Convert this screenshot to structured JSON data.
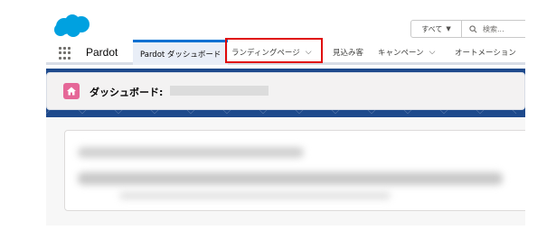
{
  "topbar": {
    "logo": "salesforce-cloud-logo",
    "search_scope": "すべて",
    "search_placeholder": "検索..."
  },
  "nav": {
    "app_name": "Pardot",
    "items": [
      {
        "label": "Pardot ダッシュボード",
        "active": true,
        "has_menu": false
      },
      {
        "label": "ランディングページ",
        "active": false,
        "has_menu": true
      },
      {
        "label": "見込み客",
        "active": false,
        "has_menu": false
      },
      {
        "label": "キャンペーン",
        "active": false,
        "has_menu": true
      },
      {
        "label": "オートメーション",
        "active": false,
        "has_menu": false
      }
    ]
  },
  "header": {
    "title": "ダッシュボード:",
    "icon": "home-icon"
  },
  "colors": {
    "brand_blue": "#00a1e0",
    "active_tab_border": "#0070d2",
    "header_icon_bg": "#e56798",
    "highlight_box": "#e00a0a",
    "band": "#1e4a8c"
  }
}
